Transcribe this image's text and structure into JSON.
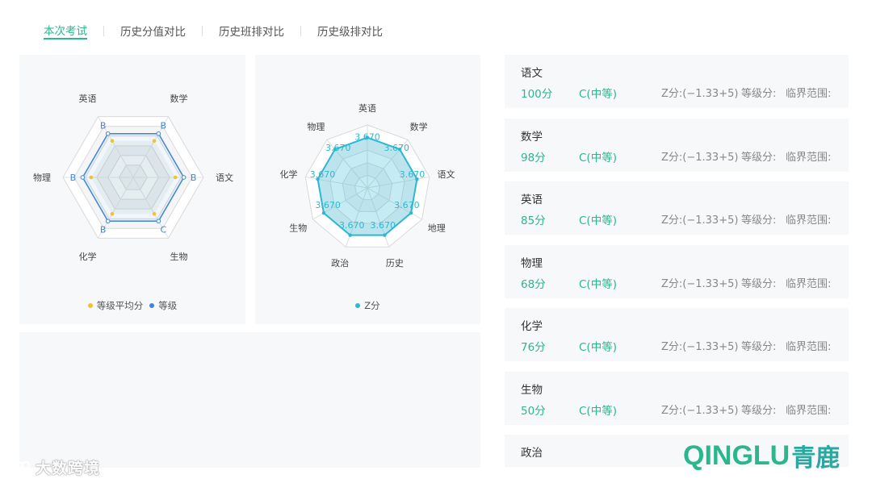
{
  "tabs": [
    {
      "label": "本次考试",
      "active": true
    },
    {
      "label": "历史分值对比",
      "active": false
    },
    {
      "label": "历史班排对比",
      "active": false
    },
    {
      "label": "历史级排对比",
      "active": false
    }
  ],
  "radar_grade": {
    "axes": [
      "数学",
      "语文",
      "生物",
      "化学",
      "物理",
      "英语"
    ],
    "point_labels": [
      "B",
      "B",
      "C",
      "B",
      "B",
      "B"
    ],
    "legend": [
      {
        "label": "等级平均分",
        "color": "#f2c12e"
      },
      {
        "label": "等级",
        "color": "#3f86d6"
      }
    ]
  },
  "radar_z": {
    "axes": [
      "英语",
      "数学",
      "语文",
      "地理",
      "历史",
      "政治",
      "生物",
      "化学",
      "物理"
    ],
    "values": [
      "3.670",
      "3.670",
      "3.670",
      "3.670",
      "3.670",
      "3.670",
      "3.670",
      "3.670",
      "3.670"
    ],
    "legend": [
      {
        "label": "Z分",
        "color": "#2db7d3"
      }
    ]
  },
  "subjects": [
    {
      "name": "语文",
      "score": "100分",
      "level": "C(中等)",
      "z": "Z分:(−1.33+5)",
      "grade": "等级分:",
      "range": "临界范围:"
    },
    {
      "name": "数学",
      "score": "98分",
      "level": "C(中等)",
      "z": "Z分:(−1.33+5)",
      "grade": "等级分:",
      "range": "临界范围:"
    },
    {
      "name": "英语",
      "score": "85分",
      "level": "C(中等)",
      "z": "Z分:(−1.33+5)",
      "grade": "等级分:",
      "range": "临界范围:"
    },
    {
      "name": "物理",
      "score": "68分",
      "level": "C(中等)",
      "z": "Z分:(−1.33+5)",
      "grade": "等级分:",
      "range": "临界范围:"
    },
    {
      "name": "化学",
      "score": "76分",
      "level": "C(中等)",
      "z": "Z分:(−1.33+5)",
      "grade": "等级分:",
      "range": "临界范围:"
    },
    {
      "name": "生物",
      "score": "50分",
      "level": "C(中等)",
      "z": "Z分:(−1.33+5)",
      "grade": "等级分:",
      "range": "临界范围:"
    },
    {
      "name": "政治"
    }
  ],
  "watermark": "大数跨境",
  "brand": {
    "latin": "QINGLU",
    "cjk": "青鹿"
  },
  "colors": {
    "accent": "#2bb68e",
    "grade_line": "#3f86d6",
    "grade_avg": "#f2c12e",
    "z_line": "#2db7d3"
  }
}
